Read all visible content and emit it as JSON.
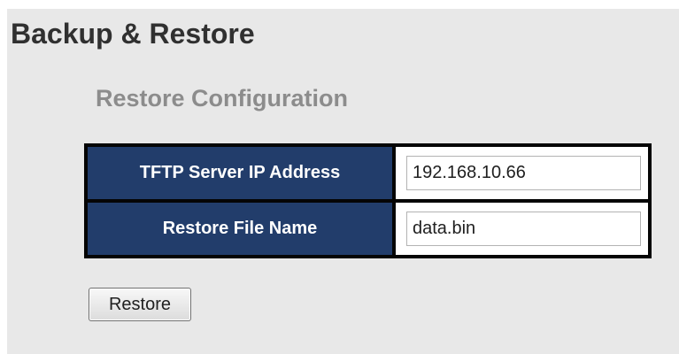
{
  "page": {
    "title": "Backup & Restore",
    "section_title": "Restore Configuration"
  },
  "form": {
    "rows": [
      {
        "label": "TFTP Server IP Address",
        "value": "192.168.10.66"
      },
      {
        "label": "Restore File Name",
        "value": "data.bin"
      }
    ],
    "submit_label": "Restore"
  },
  "colors": {
    "label_background": "#223d6b",
    "panel_background": "#e8e8e8",
    "section_title": "#8c8c8c"
  }
}
